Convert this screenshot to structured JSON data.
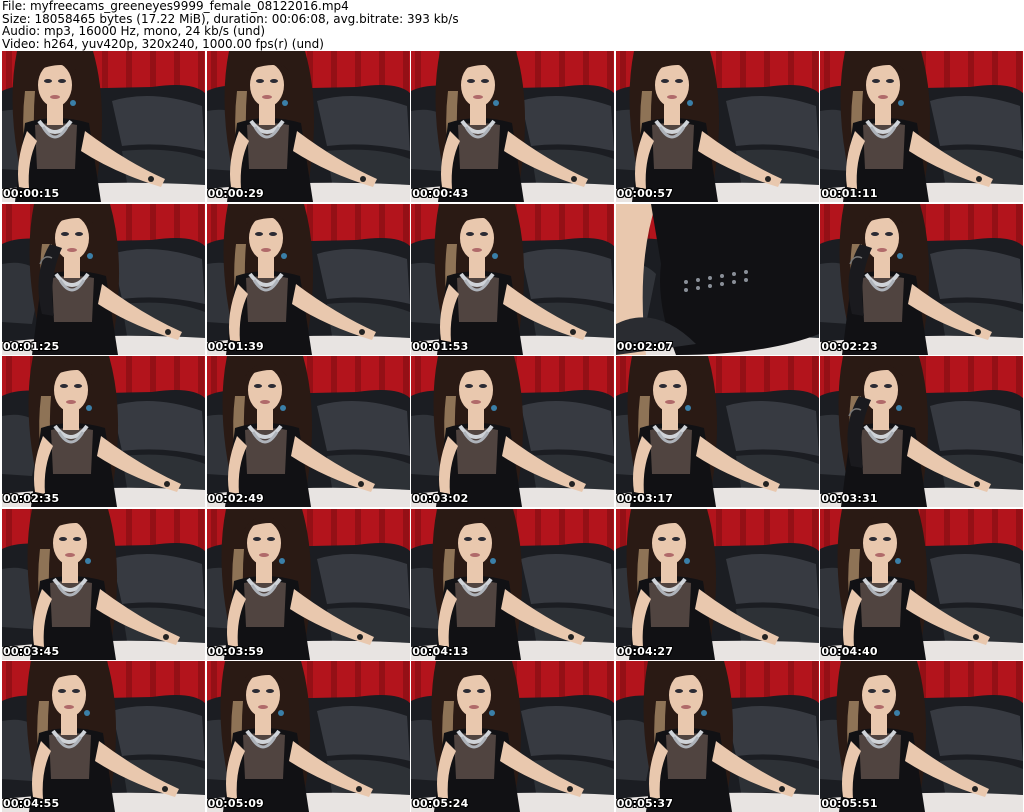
{
  "header": {
    "file": "File: myfreecams_greeneyes9999_female_08122016.mp4",
    "size": "Size: 18058465 bytes (17.22 MiB), duration: 00:06:08, avg.bitrate: 393 kb/s",
    "audio": "Audio: mp3, 16000 Hz, mono, 24 kb/s (und)",
    "video": "Video: h264, yuv420p, 320x240, 1000.00 fps(r) (und)"
  },
  "thumbnails": [
    {
      "time": "00:00:15",
      "variant": "seated"
    },
    {
      "time": "00:00:29",
      "variant": "seated"
    },
    {
      "time": "00:00:43",
      "variant": "seated"
    },
    {
      "time": "00:00:57",
      "variant": "seated"
    },
    {
      "time": "00:01:11",
      "variant": "seated"
    },
    {
      "time": "00:01:25",
      "variant": "hand-up"
    },
    {
      "time": "00:01:39",
      "variant": "seated"
    },
    {
      "time": "00:01:53",
      "variant": "seated"
    },
    {
      "time": "00:02:07",
      "variant": "dress-closeup"
    },
    {
      "time": "00:02:23",
      "variant": "hand-up"
    },
    {
      "time": "00:02:35",
      "variant": "seated"
    },
    {
      "time": "00:02:49",
      "variant": "seated"
    },
    {
      "time": "00:03:02",
      "variant": "seated"
    },
    {
      "time": "00:03:17",
      "variant": "seated"
    },
    {
      "time": "00:03:31",
      "variant": "hand-up"
    },
    {
      "time": "00:03:45",
      "variant": "seated"
    },
    {
      "time": "00:03:59",
      "variant": "seated"
    },
    {
      "time": "00:04:13",
      "variant": "seated"
    },
    {
      "time": "00:04:27",
      "variant": "seated"
    },
    {
      "time": "00:04:40",
      "variant": "seated"
    },
    {
      "time": "00:04:55",
      "variant": "seated"
    },
    {
      "time": "00:05:09",
      "variant": "seated"
    },
    {
      "time": "00:05:24",
      "variant": "seated"
    },
    {
      "time": "00:05:37",
      "variant": "seated"
    },
    {
      "time": "00:05:51",
      "variant": "seated"
    }
  ],
  "colors": {
    "curtain": "#b3141c",
    "curtain_dark": "#7a0c12",
    "couch": "#1b1d22",
    "couch_highlight": "#5b6068",
    "skin": "#e9c8ae",
    "hair": "#2a1a14",
    "dress": "#111114",
    "desk": "#e8e4e2",
    "timestamp": "#ffffff"
  }
}
